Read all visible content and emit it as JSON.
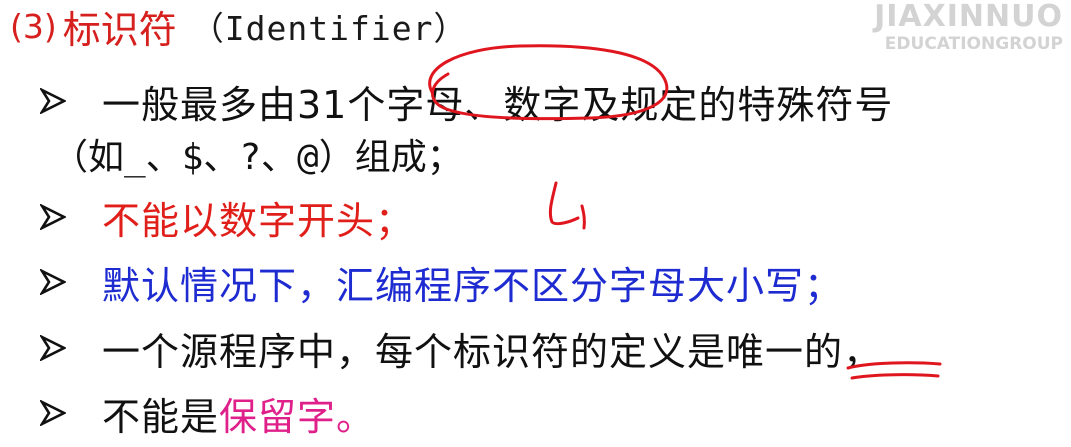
{
  "title": {
    "number": "(3)",
    "cn": "标识符",
    "en": "（Identifier）"
  },
  "watermark": {
    "line1": "JIAXINNUO",
    "line2": "EDUCATIONGROUP"
  },
  "bullets": [
    {
      "text": "一般最多由31个字母、数字及规定的特殊符号",
      "color": "#111111"
    },
    {
      "text": "不能以数字开头；",
      "color": "#e01e1a"
    },
    {
      "text": "默认情况下，汇编程序不区分字母大小写；",
      "color": "#1d2bd1"
    },
    {
      "text": "一个源程序中，每个标识符的定义是唯一的，",
      "color": "#111111"
    },
    {
      "prefix": "不能是",
      "emphasis": "保留字。",
      "prefix_color": "#111111",
      "emphasis_color": "#e0208a"
    }
  ],
  "continuation": {
    "open": "（如",
    "symbols": " _、$、?、@",
    "close": "）组成；"
  },
  "annotations": {
    "handwritten_note": "L1",
    "ink_color": "#e0161f"
  },
  "icons": {
    "bullet": "arrowhead-bullet-icon"
  }
}
